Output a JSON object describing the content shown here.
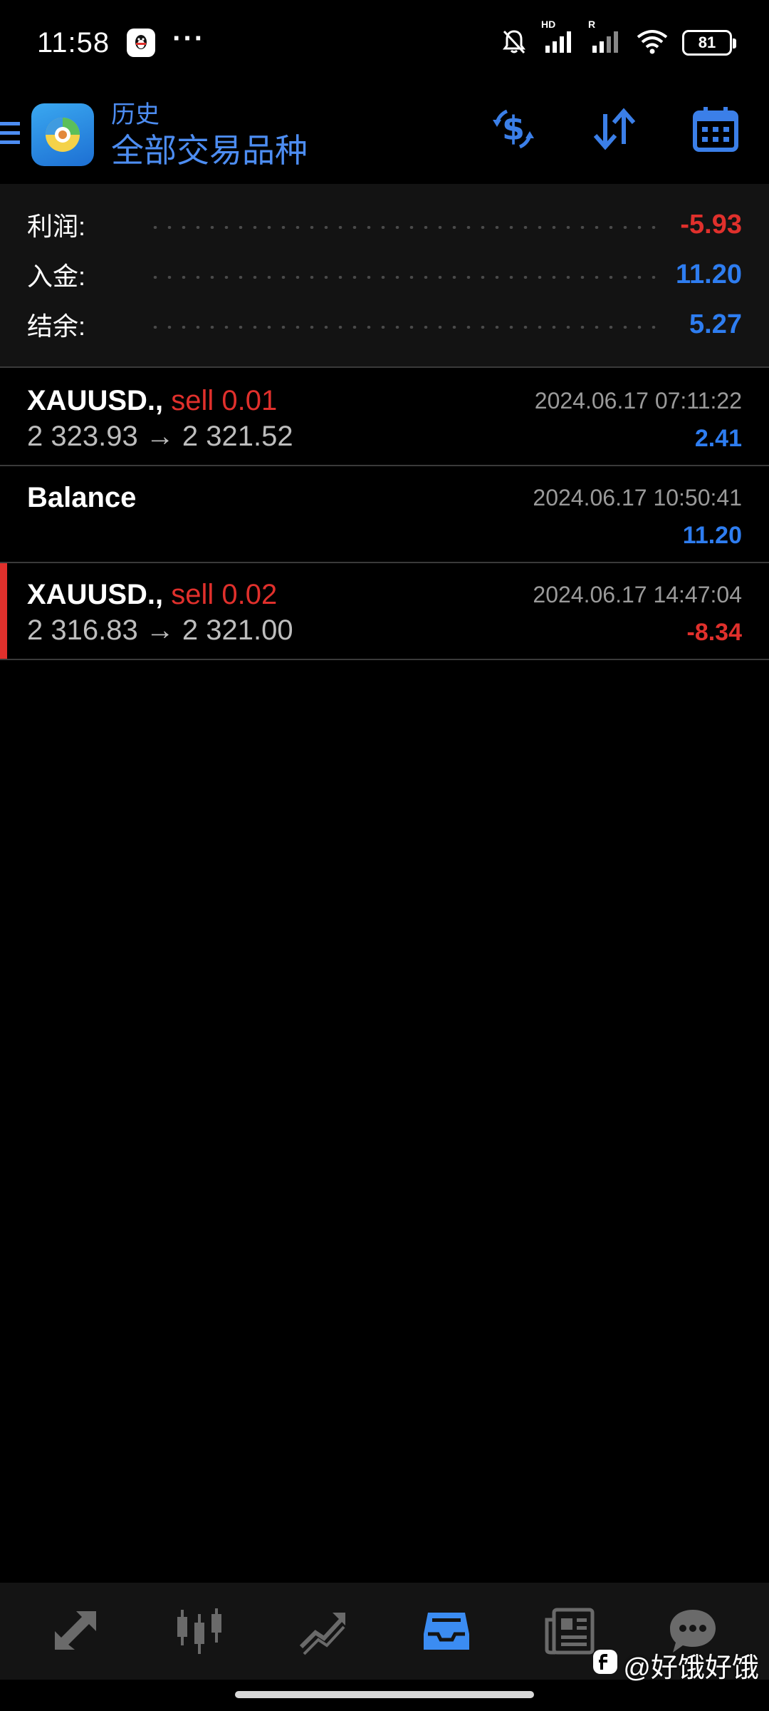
{
  "status": {
    "time": "11:58",
    "battery": "81",
    "signal_labels": [
      "HD",
      "R"
    ]
  },
  "header": {
    "subtitle": "历史",
    "title": "全部交易品种"
  },
  "summary": [
    {
      "label": "利润:",
      "value": "-5.93",
      "color": "#e0302c"
    },
    {
      "label": "入金:",
      "value": "11.20",
      "color": "#2e7df0"
    },
    {
      "label": "结余:",
      "value": "5.27",
      "color": "#2e7df0"
    }
  ],
  "deals": [
    {
      "symbol": "XAUUSD.,",
      "side": "sell 0.01",
      "prices": "2 323.93 → 2 321.52",
      "time": "2024.06.17 07:11:22",
      "profit": "2.41"
    },
    {
      "symbol": "Balance",
      "side": "",
      "prices": "",
      "time": "2024.06.17 10:50:41",
      "profit": "11.20"
    },
    {
      "symbol": "XAUUSD.,",
      "side": "sell 0.02",
      "prices": "2 316.83 → 2 321.00",
      "time": "2024.06.17 14:47:04",
      "profit": "-8.34"
    }
  ],
  "nav": [
    "quotes-icon",
    "chart-icon",
    "trade-icon",
    "history-icon",
    "news-icon",
    "messages-icon"
  ],
  "watermark": "@好饿好饿",
  "colors": {
    "accent": "#4d8df2",
    "negative": "#e0302c",
    "positive": "#2e7df0"
  }
}
